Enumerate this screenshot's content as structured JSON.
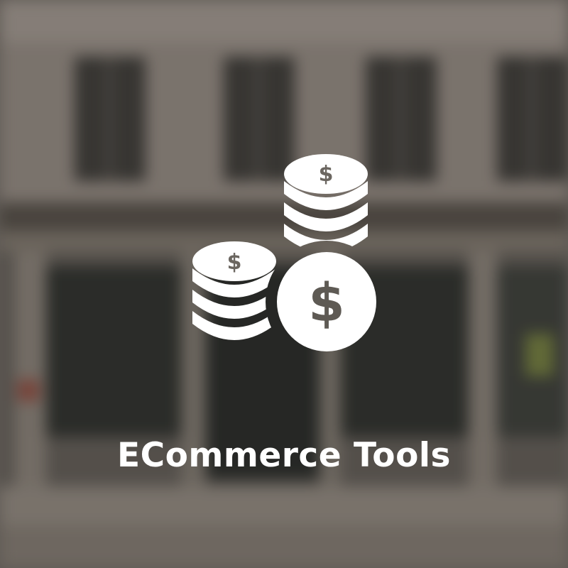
{
  "title": "ECommerce Tools",
  "icon": "stacked-dollar-coins-icon",
  "background_image": "blurred-building-facade",
  "colors": {
    "text": "#ffffff",
    "icon": "#ffffff",
    "background_tone": "#6b6660"
  }
}
